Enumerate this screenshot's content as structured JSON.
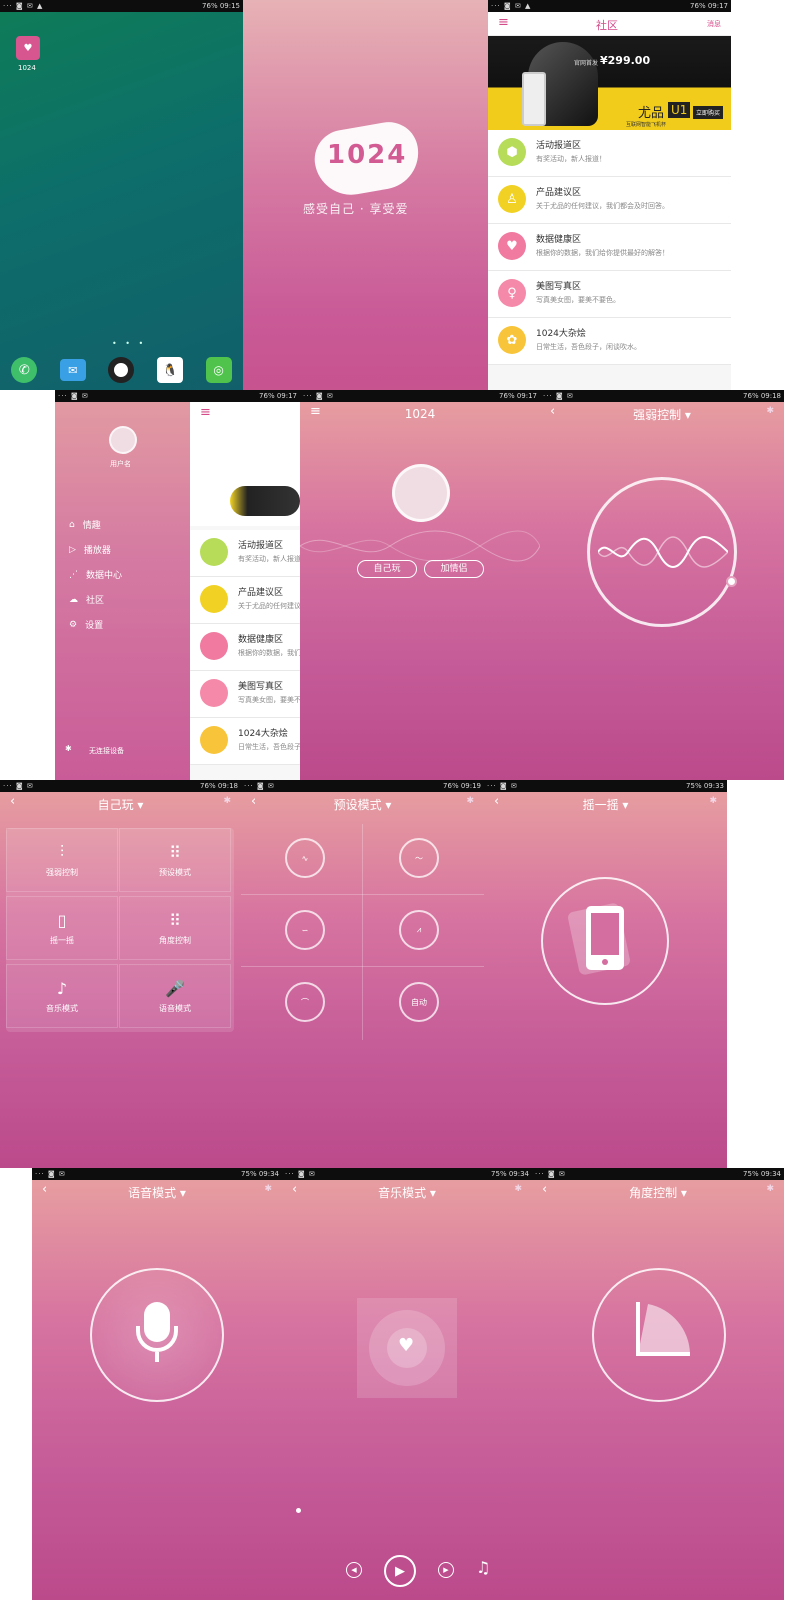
{
  "status": {
    "s1": {
      "left": "··· ◙ ✉ ▲",
      "right": "76% 09:15"
    },
    "s2": {
      "left": "",
      "right": ""
    },
    "s3": {
      "left": "··· ◙ ✉ ▲",
      "right": "76% 09:17"
    },
    "s4": {
      "left": "··· ◙ ✉",
      "right": "76% 09:17"
    },
    "s5": {
      "left": "··· ◙ ✉",
      "right": "76% 09:17"
    },
    "s6": {
      "left": "··· ◙ ✉",
      "right": "76% 09:18"
    },
    "s7": {
      "left": "··· ◙ ✉",
      "right": "76% 09:18"
    },
    "s8": {
      "left": "··· ◙ ✉",
      "right": "76% 09:19"
    },
    "s9": {
      "left": "··· ◙ ✉",
      "right": "75% 09:33"
    },
    "s10": {
      "left": "··· ◙ ✉",
      "right": "75% 09:34"
    },
    "s11": {
      "left": "··· ◙ ✉",
      "right": "75% 09:34"
    },
    "s12": {
      "left": "··· ◙ ✉",
      "right": "75% 09:34"
    }
  },
  "home": {
    "app_label": "1024"
  },
  "splash": {
    "logo": "1024",
    "slogan": "感受自己 · 享受爱"
  },
  "community": {
    "title": "社区",
    "messages": "消息",
    "banner": {
      "price": "¥299.00",
      "promo": "官网首发",
      "product": "尤品",
      "model": "U1",
      "sub": "互联网智能飞机杯",
      "buy": "立即购买"
    },
    "items": [
      {
        "title": "活动报道区",
        "desc": "有奖活动，新人报道！",
        "color": "#b6dc5a",
        "icon": "⬢"
      },
      {
        "title": "产品建议区",
        "desc": "关于尤品的任何建议，我们都会及时回答。",
        "color": "#f1d224",
        "icon": "♙"
      },
      {
        "title": "数据健康区",
        "desc": "根据你的数据，我们给你提供最好的解答！",
        "color": "#f07aa0",
        "icon": "♥"
      },
      {
        "title": "美图写真区",
        "desc": "写真美女图，要美不要色。",
        "color": "#f589a9",
        "icon": "♀"
      },
      {
        "title": "1024大杂烩",
        "desc": "日常生活，吾色段子，闲谈吹水。",
        "color": "#f8c53a",
        "icon": "✿"
      }
    ]
  },
  "drawer": {
    "username": "用户名",
    "menu": [
      "情趣",
      "播放器",
      "数据中心",
      "社区",
      "设置"
    ],
    "menu_icons": [
      "⌂",
      "▷",
      "⋰",
      "☁",
      "⚙"
    ],
    "device": "无连接设备",
    "peek_items": [
      {
        "title": "活动报道区",
        "desc": "有奖活动，新人报道",
        "color": "#b6dc5a"
      },
      {
        "title": "产品建议区",
        "desc": "关于尤品的任何建议",
        "color": "#f1d224"
      },
      {
        "title": "数据健康区",
        "desc": "根据你的数据，我们",
        "color": "#f07aa0"
      },
      {
        "title": "美图写真区",
        "desc": "写真美女图，要美不",
        "color": "#f589a9"
      },
      {
        "title": "1024大杂烩",
        "desc": "日常生活，吾色段子",
        "color": "#f8c53a"
      }
    ]
  },
  "main": {
    "title": "1024",
    "btn_solo": "自己玩",
    "btn_couple": "加情侣"
  },
  "strength": {
    "title": "强弱控制 ▾"
  },
  "solo": {
    "title": "自己玩 ▾",
    "cells": [
      {
        "label": "强弱控制",
        "icon": "⫶"
      },
      {
        "label": "预设模式",
        "icon": "⠿"
      },
      {
        "label": "摇一摇",
        "icon": "▯"
      },
      {
        "label": "角度控制",
        "icon": "⠿"
      },
      {
        "label": "音乐模式",
        "icon": "♪"
      },
      {
        "label": "语音模式",
        "icon": "🎤"
      }
    ]
  },
  "preset": {
    "title": "预设模式 ▾",
    "modes": [
      "∿",
      "〜",
      "∽",
      "⩘",
      "⌒",
      "自动"
    ]
  },
  "shake": {
    "title": "摇一摇 ▾"
  },
  "voice": {
    "title": "语音模式 ▾"
  },
  "music": {
    "title": "音乐模式 ▾"
  },
  "angle": {
    "title": "角度控制 ▾"
  }
}
